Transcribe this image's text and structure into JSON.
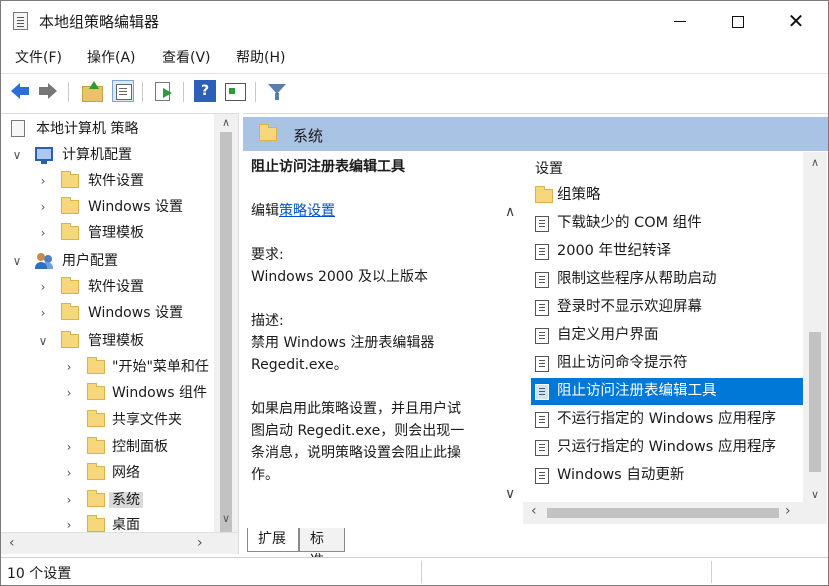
{
  "window": {
    "title": "本地组策略编辑器",
    "minimize_icon": "minimize-icon",
    "maximize_icon": "maximize-icon",
    "close_glyph": "✕"
  },
  "menu": {
    "file": "文件(F)",
    "action": "操作(A)",
    "view": "查看(V)",
    "help": "帮助(H)"
  },
  "toolbar": {
    "help_glyph": "?"
  },
  "tree": {
    "root": "本地计算机 策略",
    "computer_config": "计算机配置",
    "cc_software": "软件设置",
    "cc_windows": "Windows 设置",
    "cc_admin": "管理模板",
    "user_config": "用户配置",
    "uc_software": "软件设置",
    "uc_windows": "Windows 设置",
    "uc_admin": "管理模板",
    "start_menu": "\"开始\"菜单和任",
    "windows_components": "Windows 组件",
    "shared_folders": "共享文件夹",
    "control_panel": "控制面板",
    "network": "网络",
    "system": "系统",
    "desktop": "桌面"
  },
  "header": {
    "title": "系统"
  },
  "description": {
    "title": "阻止访问注册表编辑工具",
    "edit_prefix": "编辑",
    "edit_link": "策略设置",
    "req_label": "要求:",
    "req_value": "Windows 2000 及以上版本",
    "desc_label": "描述:",
    "desc_line1": "禁用 Windows 注册表编辑器",
    "desc_line2": "Regedit.exe。",
    "para_line1": "如果启用此策略设置，并且用户试",
    "para_line2": "图启动 Regedit.exe，则会出现一",
    "para_line3": "条消息，说明策略设置会阻止此操",
    "para_line4": "作。"
  },
  "list": {
    "column_header": "设置",
    "items": [
      "组策略",
      "下载缺少的 COM 组件",
      "2000 年世纪转译",
      "限制这些程序从帮助启动",
      "登录时不显示欢迎屏幕",
      "自定义用户界面",
      "阻止访问命令提示符",
      "阻止访问注册表编辑工具",
      "不运行指定的 Windows 应用程序",
      "只运行指定的 Windows 应用程序",
      "Windows 自动更新"
    ],
    "selected_index": 7
  },
  "tabs": {
    "expanded": "扩展",
    "standard": "标准"
  },
  "status": {
    "count": "10 个设置"
  },
  "colors": {
    "accent": "#0078d7",
    "header_band": "#a8c3e3",
    "link": "#0052cc"
  }
}
